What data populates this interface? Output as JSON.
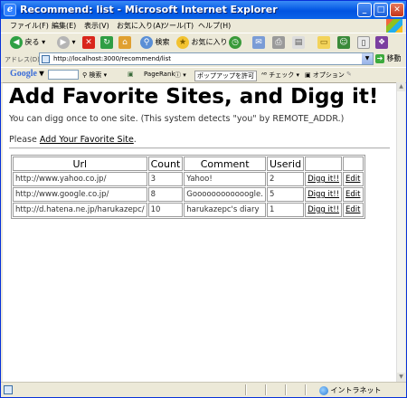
{
  "window": {
    "title": "Recommend: list - Microsoft Internet Explorer",
    "min_glyph": "_",
    "max_glyph": "□",
    "close_glyph": "✕"
  },
  "menu": {
    "items": [
      "ファイル(F)",
      "編集(E)",
      "表示(V)",
      "お気に入り(A)",
      "ツール(T)",
      "ヘルプ(H)"
    ]
  },
  "toolbar": {
    "back_label": "戻る",
    "search_label": "検索",
    "favorites_label": "お気に入り"
  },
  "address": {
    "label": "アドレス(D)",
    "url": "http://localhost:3000/recommend/list",
    "go_label": "移動"
  },
  "googlebar": {
    "logo": "Google",
    "search_label": "検索",
    "pagerank_label": "PageRank",
    "popup_label": "ポップアップを許可",
    "spell_label": "チェック",
    "options_label": "オプション"
  },
  "page": {
    "heading": "Add Favorite Sites, and Digg it!",
    "description": "You can digg once to one site. (This system detects \"you\" by REMOTE_ADDR.)",
    "please_prefix": "Please ",
    "add_link": "Add Your Favorite Site",
    "please_suffix": "."
  },
  "table": {
    "headers": [
      "Url",
      "Count",
      "Comment",
      "Userid"
    ],
    "rows": [
      {
        "url": "http://www.yahoo.co.jp/",
        "count": "3",
        "comment": "Yahoo!",
        "userid": "2",
        "digg": "Digg it!!",
        "edit": "Edit"
      },
      {
        "url": "http://www.google.co.jp/",
        "count": "8",
        "comment": "Goooooooooooogle.",
        "userid": "5",
        "digg": "Digg it!!",
        "edit": "Edit"
      },
      {
        "url": "http://d.hatena.ne.jp/harukazepc/",
        "count": "10",
        "comment": "harukazepc's diary",
        "userid": "1",
        "digg": "Digg it!!",
        "edit": "Edit"
      }
    ]
  },
  "status": {
    "zone": "イントラネット"
  },
  "colors": {
    "titlebar": "#0a5ee6",
    "chrome": "#ece9d8"
  }
}
